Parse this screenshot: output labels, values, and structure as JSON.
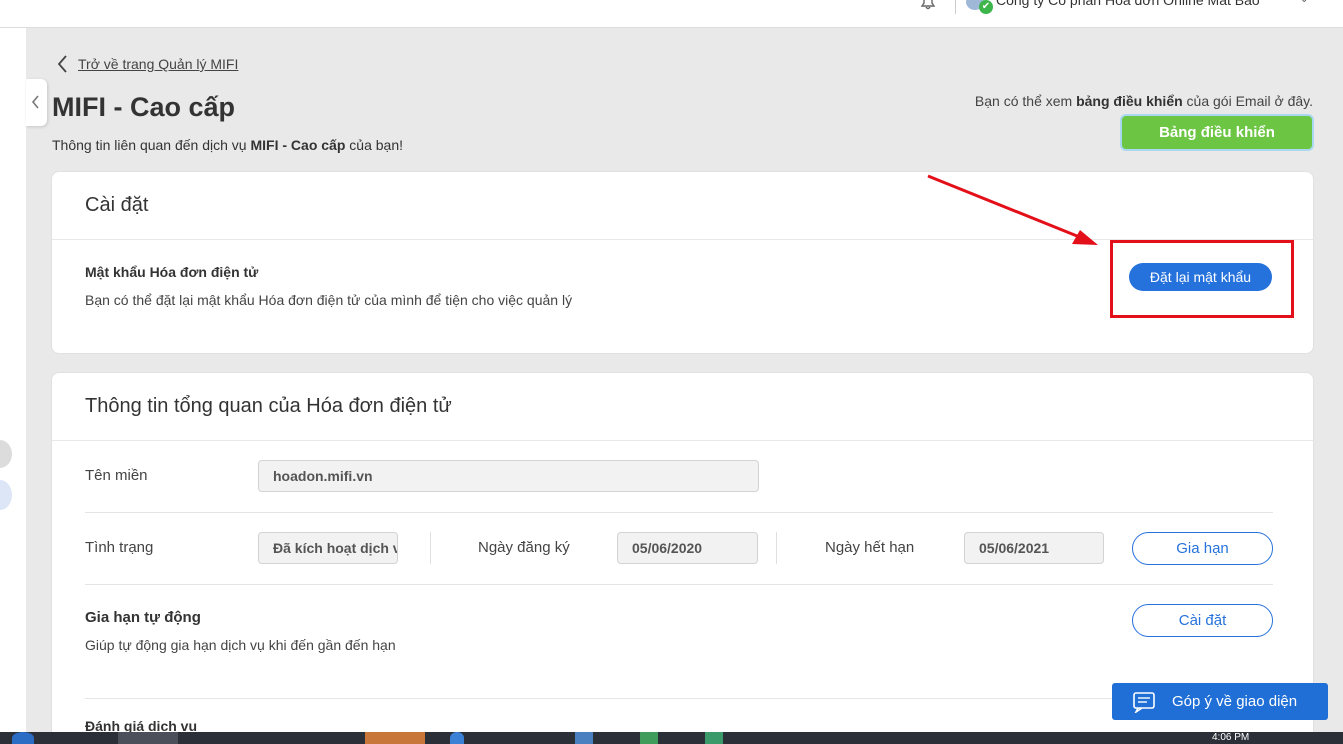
{
  "topbar": {
    "company_name": "Công ty Cổ phần Hóa đơn Online Mắt Bão",
    "company_check_icon": "✔",
    "company_caret": "⌄"
  },
  "back_link": {
    "label": "Trở về trang Quản lý MIFI"
  },
  "page": {
    "title": "MIFI - Cao cấp",
    "subtitle_prefix": "Thông tin liên quan đến dịch vụ ",
    "subtitle_bold": "MIFI - Cao cấp",
    "subtitle_suffix": " của bạn!"
  },
  "dashboard": {
    "hint_prefix": "Bạn có thể xem ",
    "hint_bold": "bảng điều khiển",
    "hint_suffix": " của gói Email ở đây.",
    "button_label": "Bảng điều khiển",
    "button_color": "#6cc644"
  },
  "settings_card": {
    "title": "Cài đặt",
    "password_label": "Mật khẩu Hóa đơn điện tử",
    "password_desc": "Bạn có thể đặt lại mật khẩu Hóa đơn điện tử của mình để tiện cho việc quản lý",
    "reset_button": "Đặt lại mật khẩu",
    "accent": "#2672dc"
  },
  "overview_card": {
    "title": "Thông tin tổng quan của Hóa đơn điện tử",
    "domain_label": "Tên miền",
    "domain_value": "hoadon.mifi.vn",
    "status_label": "Tình trạng",
    "status_value": "Đã kích hoạt dịch vụ",
    "reg_date_label": "Ngày đăng ký",
    "reg_date_value": "05/06/2020",
    "exp_date_label": "Ngày hết hạn",
    "exp_date_value": "05/06/2021",
    "renew_button": "Gia hạn",
    "auto_renew_label": "Gia hạn tự động",
    "auto_renew_desc": "Giúp tự động gia hạn dịch vụ khi đến gần đến hạn",
    "auto_renew_button": "Cài đặt",
    "rating_label": "Đánh giá dịch vụ"
  },
  "feedback": {
    "label": "Góp ý về giao diện"
  },
  "taskbar": {
    "time": "4:06 PM"
  },
  "annotation": {
    "color": "#e3101a"
  }
}
